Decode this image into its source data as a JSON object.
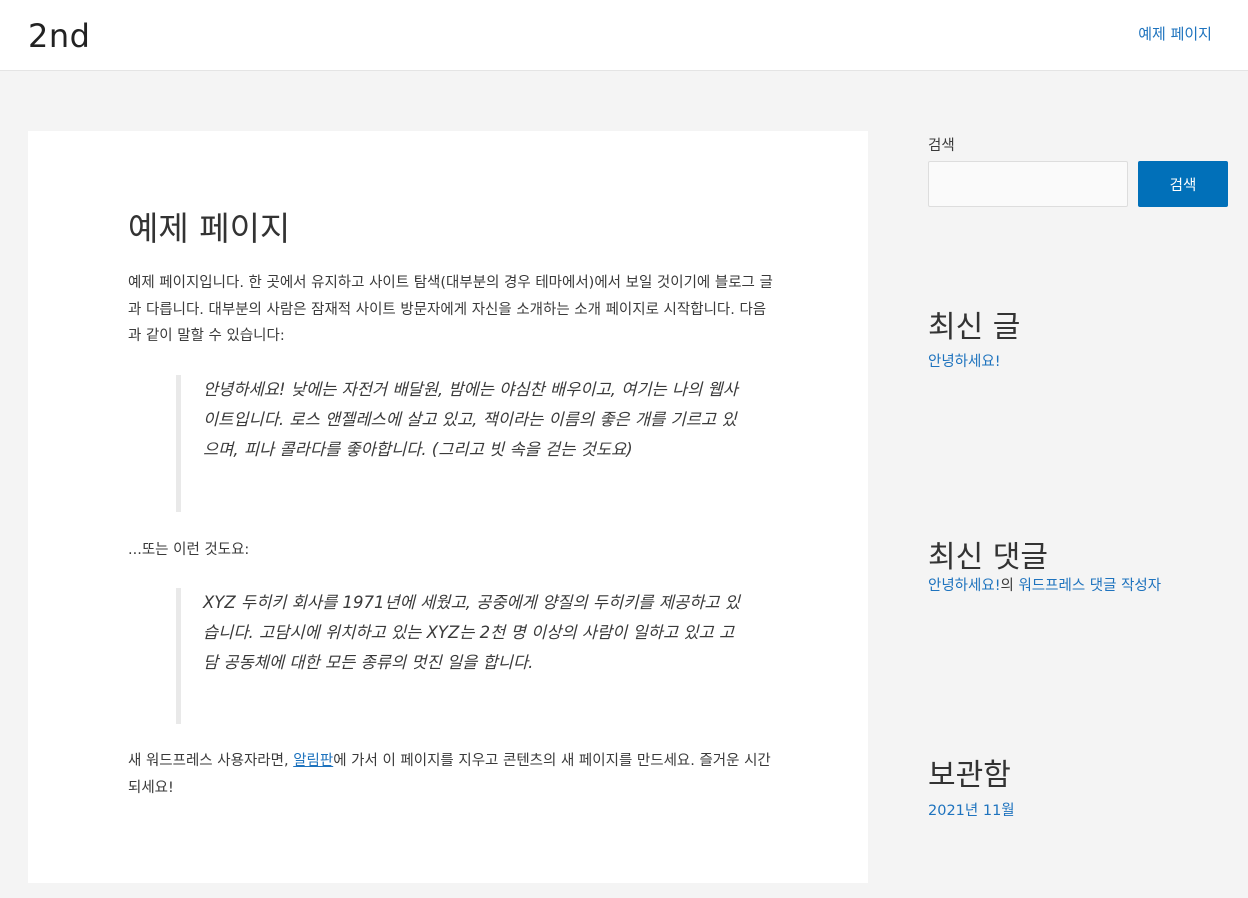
{
  "header": {
    "site_title": "2nd",
    "nav": [
      "예제 페이지"
    ]
  },
  "article": {
    "title": "예제 페이지",
    "intro": "예제 페이지입니다. 한 곳에서 유지하고 사이트 탐색(대부분의 경우 테마에서)에서 보일 것이기에 블로그 글과 다릅니다. 대부분의 사람은 잠재적 사이트 방문자에게 자신을 소개하는 소개 페이지로 시작합니다. 다음과 같이 말할 수 있습니다:",
    "quote1": "안녕하세요! 낮에는 자전거 배달원, 밤에는 야심찬 배우이고, 여기는 나의 웹사이트입니다. 로스 앤젤레스에 살고 있고, 잭이라는 이름의 좋은 개를 기르고 있으며, 피나 콜라다를 좋아합니다. (그리고 빗 속을 걷는 것도요)",
    "middle": "...또는 이런 것도요:",
    "quote2": "XYZ 두히키 회사를 1971년에 세웠고, 공중에게 양질의 두히키를 제공하고 있습니다. 고담시에 위치하고 있는 XYZ는 2천 명 이상의 사람이 일하고 있고 고담 공동체에 대한 모든 종류의 멋진 일을 합니다.",
    "closing_before": "새 워드프레스 사용자라면, ",
    "closing_link": "알림판",
    "closing_after": "에 가서 이 페이지를 지우고 콘텐츠의 새 페이지를 만드세요. 즐거운 시간되세요!"
  },
  "sidebar": {
    "search": {
      "label": "검색",
      "value": "",
      "button": "검색"
    },
    "recent_posts": {
      "title": "최신 글",
      "items": [
        "안녕하세요!"
      ]
    },
    "recent_comments": {
      "title": "최신 댓글",
      "author": "안녕하세요!의 워드프레스 댓글 작성자",
      "author_link": "워드프레스 댓글 작성자",
      "post_link": "안녕하세요!",
      "connector": "의 "
    },
    "archives": {
      "title": "보관함",
      "items": [
        "2021년 11월"
      ]
    }
  },
  "colors": {
    "accent": "#0170b9",
    "link": "#1e73be",
    "background": "#f4f4f4"
  }
}
